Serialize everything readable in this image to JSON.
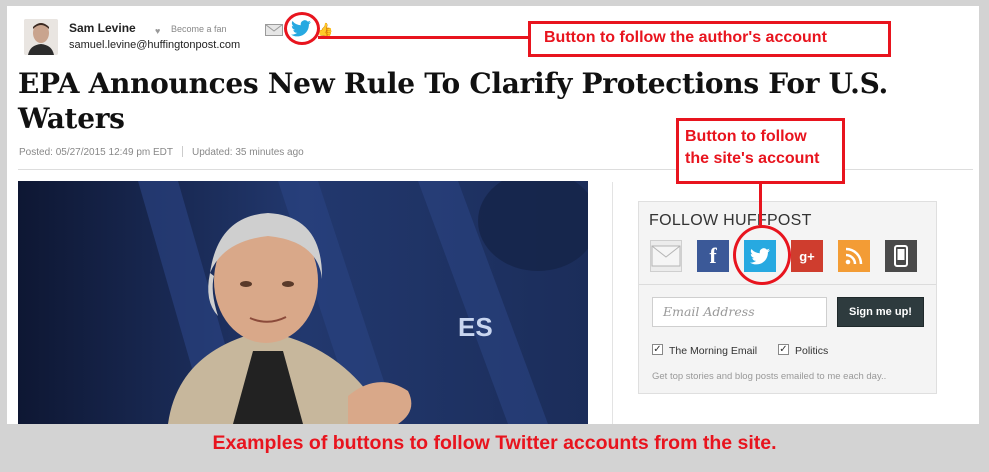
{
  "byline": {
    "author_name": "Sam Levine",
    "become_fan": "Become a fan",
    "email": "samuel.levine@huffingtonpost.com",
    "icons": [
      "heart-icon",
      "mail-icon",
      "twitter-icon",
      "thumbs-up-icon"
    ]
  },
  "article": {
    "title": "EPA Announces New Rule To Clarify Protections For U.S. Waters",
    "posted": "Posted: 05/27/2015 12:49 pm EDT",
    "updated": "Updated: 35 minutes ago",
    "photo_text": "ES"
  },
  "follow_widget": {
    "title": "FOLLOW HUFFPOST",
    "social_icons": [
      "mail-icon",
      "facebook-icon",
      "twitter-icon",
      "google-plus-icon",
      "rss-icon",
      "mobile-icon"
    ],
    "email_placeholder": "Email Address",
    "signup_label": "Sign me up!",
    "options": [
      {
        "label": "The Morning Email",
        "checked": true
      },
      {
        "label": "Politics",
        "checked": true
      }
    ],
    "note": "Get top stories and blog posts emailed to me each day.."
  },
  "annotations": {
    "author_callout": "Button to follow the author's account",
    "site_callout_line1": "Button to follow",
    "site_callout_line2": "the site's account",
    "caption": "Examples of buttons to follow Twitter accounts from the site.",
    "accent_color": "#e8141e"
  },
  "colors": {
    "twitter": "#27a9e1",
    "facebook": "#3b5998",
    "google_plus": "#cf3d2e",
    "rss": "#f39c35"
  }
}
